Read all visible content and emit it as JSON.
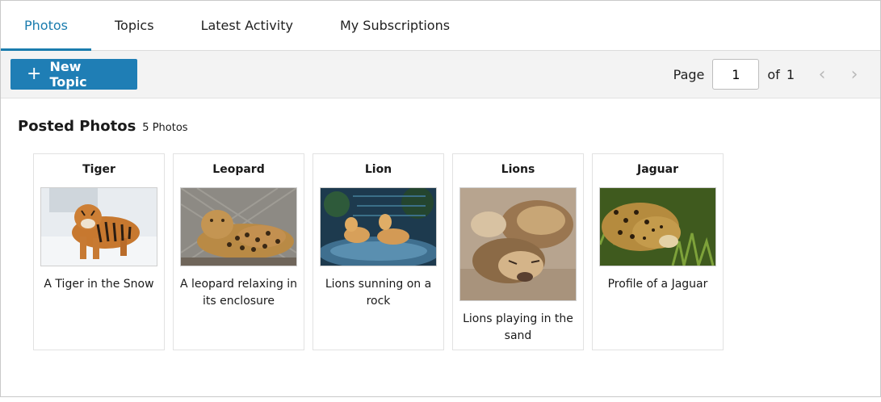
{
  "tabs": [
    {
      "label": "Photos",
      "active": true
    },
    {
      "label": "Topics"
    },
    {
      "label": "Latest Activity"
    },
    {
      "label": "My Subscriptions"
    }
  ],
  "toolbar": {
    "new_topic_label": "New Topic",
    "page_label": "Page",
    "page_value": "1",
    "of_label": "of",
    "total_pages": "1"
  },
  "section": {
    "title": "Posted Photos",
    "count": "5 Photos"
  },
  "photos": [
    {
      "title": "Tiger",
      "caption": "A Tiger in the Snow"
    },
    {
      "title": "Leopard",
      "caption": "A leopard relaxing in its enclosure"
    },
    {
      "title": "Lion",
      "caption": "Lions sunning on a rock"
    },
    {
      "title": "Lions",
      "caption": "Lions playing in the sand"
    },
    {
      "title": "Jaguar",
      "caption": "Profile of a Jaguar"
    }
  ],
  "colors": {
    "accent": "#1a7cae",
    "button": "#1f7eb5"
  }
}
